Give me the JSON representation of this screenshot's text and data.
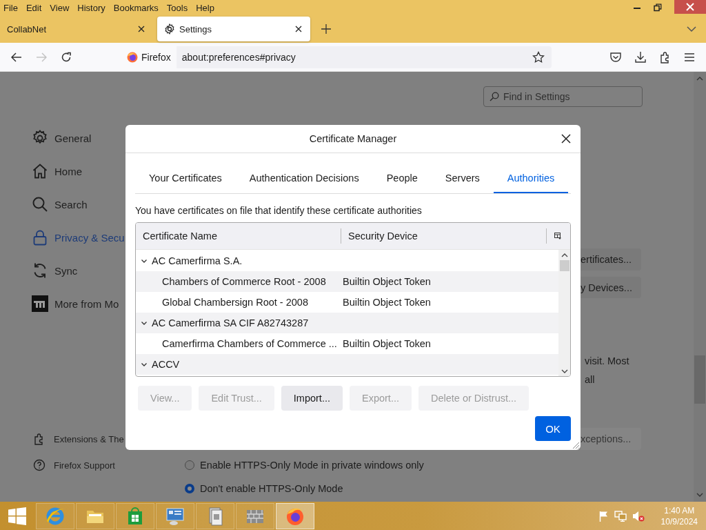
{
  "menu_bar": [
    "File",
    "Edit",
    "View",
    "History",
    "Bookmarks",
    "Tools",
    "Help"
  ],
  "tabs": [
    {
      "label": "CollabNet",
      "selected": false
    },
    {
      "label": "Settings",
      "selected": true
    }
  ],
  "nav_buttons": [
    {
      "kind": "back",
      "disabled": false
    },
    {
      "kind": "forward",
      "disabled": true
    },
    {
      "kind": "reload",
      "disabled": false
    }
  ],
  "url_bar": {
    "identity": "Firefox",
    "url": "about:preferences#privacy"
  },
  "settings_page": {
    "search": {
      "placeholder": "Find in Settings"
    },
    "categories": [
      {
        "kind": "gear",
        "label": "General",
        "selected": false
      },
      {
        "kind": "home",
        "label": "Home",
        "selected": false
      },
      {
        "kind": "search",
        "label": "Search",
        "selected": false
      },
      {
        "kind": "lock",
        "label": "Privacy & Secu",
        "selected": true
      },
      {
        "kind": "sync",
        "label": "Sync",
        "selected": false
      },
      {
        "kind": "square",
        "label": "More from Mo",
        "selected": false
      }
    ],
    "footer_links": [
      {
        "kind": "puzzle",
        "label": "Extensions & The"
      },
      {
        "kind": "help",
        "label": "Firefox Support"
      }
    ],
    "right_fragments": [
      {
        "kind": "button",
        "label": "ertificates...",
        "disabled": false
      },
      {
        "kind": "button",
        "label": "y Devices...",
        "disabled": false
      },
      {
        "kind": "text",
        "label": "visit. Most"
      },
      {
        "kind": "text",
        "label": "all"
      },
      {
        "kind": "button",
        "label": "xceptions...",
        "disabled": true
      }
    ],
    "https_options": [
      {
        "label": "Enable HTTPS-Only Mode in private windows only",
        "selected": false
      },
      {
        "label": "Don't enable HTTPS-Only Mode",
        "selected": true
      }
    ]
  },
  "dialog": {
    "title": "Certificate Manager",
    "tabs": [
      {
        "label": "Your Certificates",
        "selected": false
      },
      {
        "label": "Authentication Decisions",
        "selected": false
      },
      {
        "label": "People",
        "selected": false
      },
      {
        "label": "Servers",
        "selected": false
      },
      {
        "label": "Authorities",
        "selected": true
      }
    ],
    "description": "You have certificates on file that identify these certificate authorities",
    "tree": {
      "columns": [
        "Certificate Name",
        "Security Device"
      ],
      "groups": [
        {
          "name": "AC Camerfirma S.A.",
          "expanded": true,
          "children": [
            {
              "name": "Chambers of Commerce Root - 2008",
              "device": "Builtin Object Token"
            },
            {
              "name": "Global Chambersign Root - 2008",
              "device": "Builtin Object Token"
            }
          ]
        },
        {
          "name": "AC Camerfirma SA CIF A82743287",
          "expanded": true,
          "children": [
            {
              "name": "Camerfirma Chambers of Commerce ...",
              "device": "Builtin Object Token"
            }
          ]
        },
        {
          "name": "ACCV",
          "expanded": true
        }
      ]
    },
    "buttons": [
      {
        "label": "View...",
        "disabled": true
      },
      {
        "label": "Edit Trust...",
        "disabled": true
      },
      {
        "label": "Import...",
        "disabled": false
      },
      {
        "label": "Export...",
        "disabled": true
      },
      {
        "label": "Delete or Distrust...",
        "disabled": true
      }
    ],
    "ok_button": "OK"
  },
  "taskbar": {
    "apps": [
      {
        "kind": "browser",
        "active": false
      },
      {
        "kind": "folder",
        "active": false
      },
      {
        "kind": "store",
        "active": false
      },
      {
        "kind": "monitor",
        "active": false
      },
      {
        "kind": "documents",
        "active": false
      },
      {
        "kind": "wall",
        "active": false
      },
      {
        "kind": "firefox",
        "active": true
      }
    ],
    "time": "1:40 AM",
    "date": "10/9/2024"
  }
}
